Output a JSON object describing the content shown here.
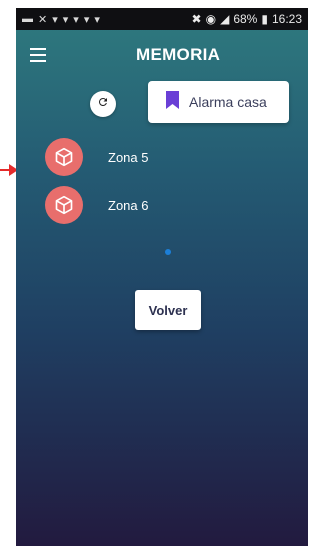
{
  "status_bar": {
    "battery": "68%",
    "time": "16:23"
  },
  "header": {
    "title": "MEMORIA"
  },
  "alarm": {
    "label": "Alarma casa"
  },
  "zones": [
    {
      "label": "Zona 5"
    },
    {
      "label": "Zona 6"
    }
  ],
  "footer": {
    "back_label": "Volver"
  },
  "colors": {
    "zone_icon_bg": "#e86e6c",
    "accent": "#1c7fd8",
    "bookmark": "#6a3fd6"
  },
  "icons": {
    "menu": "hamburger-menu-icon",
    "refresh": "refresh-icon",
    "bookmark": "bookmark-icon",
    "zone": "cube-icon"
  }
}
